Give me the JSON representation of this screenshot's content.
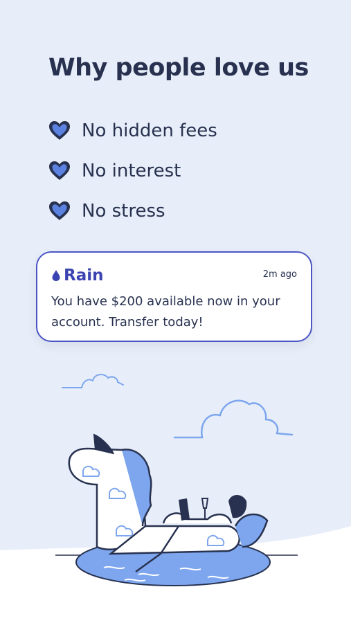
{
  "heading": "Why people love us",
  "features": [
    {
      "label": "No hidden fees",
      "icon": "heart-icon"
    },
    {
      "label": "No interest",
      "icon": "heart-icon"
    },
    {
      "label": "No stress",
      "icon": "heart-icon"
    }
  ],
  "notification": {
    "brand": "Rain",
    "brand_icon": "raindrop-icon",
    "time": "2m ago",
    "message": "You have $200 available now in your account. Transfer today!"
  },
  "colors": {
    "background": "#e7eef9",
    "text": "#283250",
    "accent": "#3b44b0",
    "heart_fill": "#5b82e0",
    "illustration_blue": "#7da6ee"
  }
}
